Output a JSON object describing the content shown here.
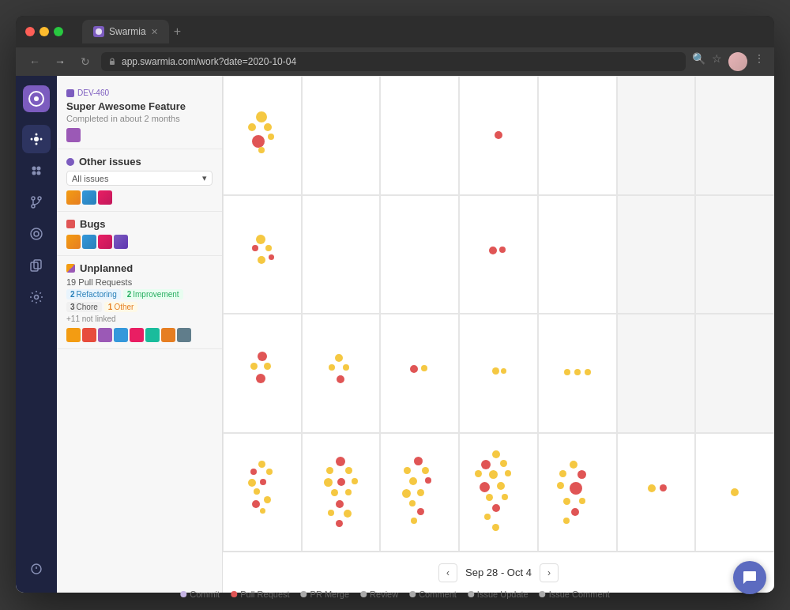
{
  "browser": {
    "tab_title": "Swarmia",
    "url": "app.swarmia.com/work?date=2020-10-04",
    "tab_new": "+"
  },
  "nav": {
    "back": "‹",
    "forward": "›",
    "refresh": "↻"
  },
  "sidebar": {
    "logo": "S",
    "items": [
      {
        "label": "home",
        "icon": "⬡"
      },
      {
        "label": "insights",
        "icon": "✦"
      },
      {
        "label": "pull-requests",
        "icon": "⑂"
      },
      {
        "label": "activity",
        "icon": "◎"
      },
      {
        "label": "copy",
        "icon": "❐"
      },
      {
        "label": "settings",
        "icon": "⚙"
      },
      {
        "label": "logout",
        "icon": "↩"
      }
    ]
  },
  "left_panel": {
    "feature": {
      "tag": "DEV-460",
      "title": "Super Awesome Feature",
      "subtitle": "Completed in about 2 months",
      "icon_color": "purple"
    },
    "other_issues": {
      "title": "Other issues",
      "select_label": "All issues"
    },
    "bugs": {
      "title": "Bugs",
      "icon_color": "red"
    },
    "unplanned": {
      "title": "Unplanned",
      "pull_requests": "19 Pull Requests",
      "badges": [
        {
          "count": "2",
          "label": "Refactoring",
          "type": "refactor"
        },
        {
          "count": "2",
          "label": "Improvement",
          "type": "improve"
        },
        {
          "count": "3",
          "label": "Chore",
          "type": "chore"
        },
        {
          "count": "1",
          "label": "Other",
          "type": "other"
        }
      ],
      "not_linked": "+11 not linked"
    }
  },
  "date_range": "Sep 28 - Oct 4",
  "legend": {
    "items": [
      {
        "label": "Commit",
        "color": "#c5b4e3"
      },
      {
        "label": "Pull Request",
        "color": "#e05555"
      },
      {
        "label": "PR Merge",
        "color": "#bdbdbd"
      },
      {
        "label": "Review",
        "color": "#bdbdbd"
      },
      {
        "label": "Comment",
        "color": "#bdbdbd"
      },
      {
        "label": "Issue Update",
        "color": "#bdbdbd"
      },
      {
        "label": "Issue Comment",
        "color": "#bdbdbd"
      }
    ]
  },
  "chat_icon": "💬"
}
